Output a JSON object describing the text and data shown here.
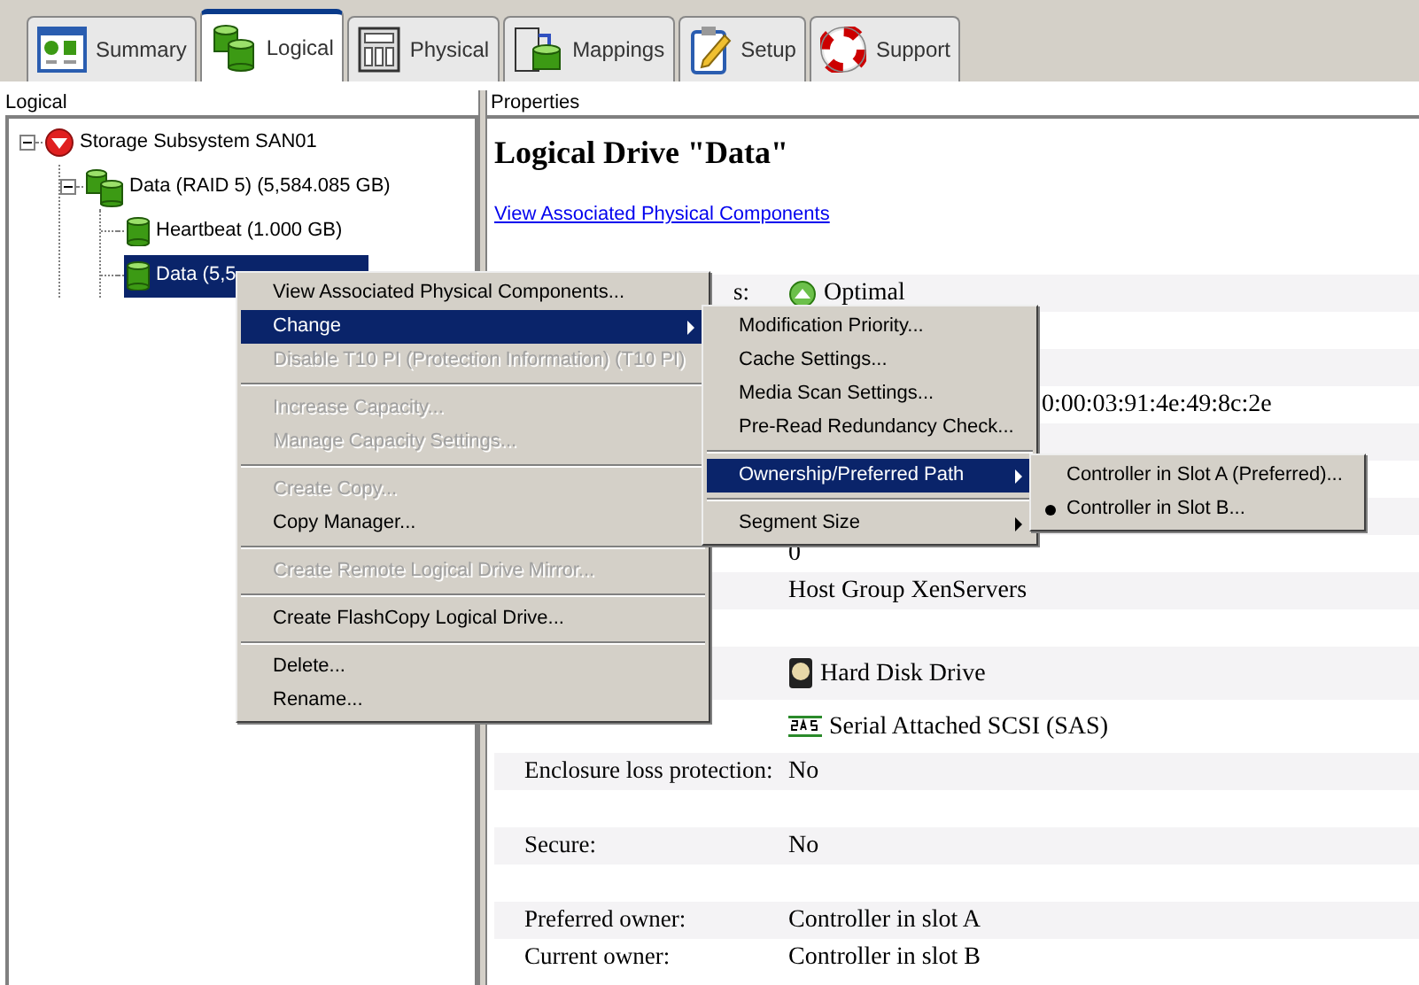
{
  "tabs": [
    {
      "label": "Summary",
      "kind": "summary",
      "selected": false
    },
    {
      "label": "Logical",
      "kind": "logical",
      "selected": true
    },
    {
      "label": "Physical",
      "kind": "physical",
      "selected": false
    },
    {
      "label": "Mappings",
      "kind": "mappings",
      "selected": false
    },
    {
      "label": "Setup",
      "kind": "setup",
      "selected": false
    },
    {
      "label": "Support",
      "kind": "support",
      "selected": false
    }
  ],
  "tree_panel": {
    "title": "Logical",
    "tree": [
      {
        "label": "Storage Subsystem SAN01",
        "kind": "subsystem",
        "expanded": true,
        "selected": false,
        "children": [
          {
            "label": "Data (RAID 5) (5,584.085 GB)",
            "kind": "array",
            "expanded": true,
            "selected": false,
            "children": [
              {
                "label": "Heartbeat (1.000 GB)",
                "kind": "drive",
                "selected": false
              },
              {
                "label": "Data (5,5",
                "kind": "drive",
                "selected": true
              }
            ]
          }
        ]
      }
    ]
  },
  "properties_panel": {
    "title": "Properties",
    "heading": "Logical Drive \"Data\"",
    "link": "View Associated Physical Components",
    "rows": [
      {
        "kind": "status",
        "label": "s:",
        "value": "Optimal"
      },
      {
        "kind": "blank"
      },
      {
        "kind": "blank"
      },
      {
        "kind": "tail",
        "value": "0:00:03:91:4e:49:8c:2e"
      },
      {
        "kind": "blank"
      },
      {
        "kind": "blank"
      },
      {
        "kind": "blank"
      },
      {
        "kind": "text",
        "value": "0"
      },
      {
        "kind": "text",
        "value": "Host Group XenServers"
      },
      {
        "kind": "blank"
      },
      {
        "kind": "drive",
        "value": "Hard Disk Drive"
      },
      {
        "kind": "interface",
        "value": "Serial Attached SCSI (SAS)"
      },
      {
        "kind": "text",
        "label": "Enclosure loss protection:",
        "value": "No"
      },
      {
        "kind": "blank"
      },
      {
        "kind": "text",
        "label": "Secure:",
        "value": "No"
      },
      {
        "kind": "blank"
      },
      {
        "kind": "text",
        "label": "Preferred owner:",
        "value": "Controller in slot A"
      },
      {
        "kind": "text",
        "label": "Current owner:",
        "value": "Controller in slot B"
      }
    ]
  },
  "context_menu": [
    {
      "kind": "item",
      "label": "View Associated Physical Components...",
      "disabled": false,
      "selected": false
    },
    {
      "kind": "submenu",
      "label": "Change",
      "disabled": false,
      "selected": true,
      "children": [
        {
          "kind": "item",
          "label": "Modification Priority...",
          "disabled": false,
          "selected": false
        },
        {
          "kind": "item",
          "label": "Cache Settings...",
          "disabled": false,
          "selected": false
        },
        {
          "kind": "item",
          "label": "Media Scan Settings...",
          "disabled": false,
          "selected": false
        },
        {
          "kind": "item",
          "label": "Pre-Read Redundancy Check...",
          "disabled": false,
          "selected": false
        },
        {
          "kind": "separator"
        },
        {
          "kind": "submenu",
          "label": "Ownership/Preferred Path",
          "disabled": false,
          "selected": true,
          "children": [
            {
              "kind": "radio",
              "label": "Controller in Slot A (Preferred)...",
              "disabled": false,
              "selected": false,
              "checked": false
            },
            {
              "kind": "radio",
              "label": "Controller in Slot B...",
              "disabled": false,
              "selected": false,
              "checked": true
            }
          ]
        },
        {
          "kind": "separator"
        },
        {
          "kind": "submenu",
          "label": "Segment Size",
          "disabled": false,
          "selected": false
        }
      ]
    },
    {
      "kind": "item",
      "label": "Disable T10 PI (Protection Information) (T10 PI)",
      "disabled": true,
      "selected": false
    },
    {
      "kind": "separator"
    },
    {
      "kind": "item",
      "label": "Increase Capacity...",
      "disabled": true,
      "selected": false
    },
    {
      "kind": "item",
      "label": "Manage Capacity Settings...",
      "disabled": true,
      "selected": false
    },
    {
      "kind": "separator"
    },
    {
      "kind": "item",
      "label": "Create Copy...",
      "disabled": true,
      "selected": false
    },
    {
      "kind": "item",
      "label": "Copy Manager...",
      "disabled": false,
      "selected": false
    },
    {
      "kind": "separator"
    },
    {
      "kind": "item",
      "label": "Create Remote Logical Drive Mirror...",
      "disabled": true,
      "selected": false
    },
    {
      "kind": "separator"
    },
    {
      "kind": "item",
      "label": "Create FlashCopy Logical Drive...",
      "disabled": false,
      "selected": false
    },
    {
      "kind": "separator"
    },
    {
      "kind": "item",
      "label": "Delete...",
      "disabled": false,
      "selected": false
    },
    {
      "kind": "item",
      "label": "Rename...",
      "disabled": false,
      "selected": false
    }
  ]
}
